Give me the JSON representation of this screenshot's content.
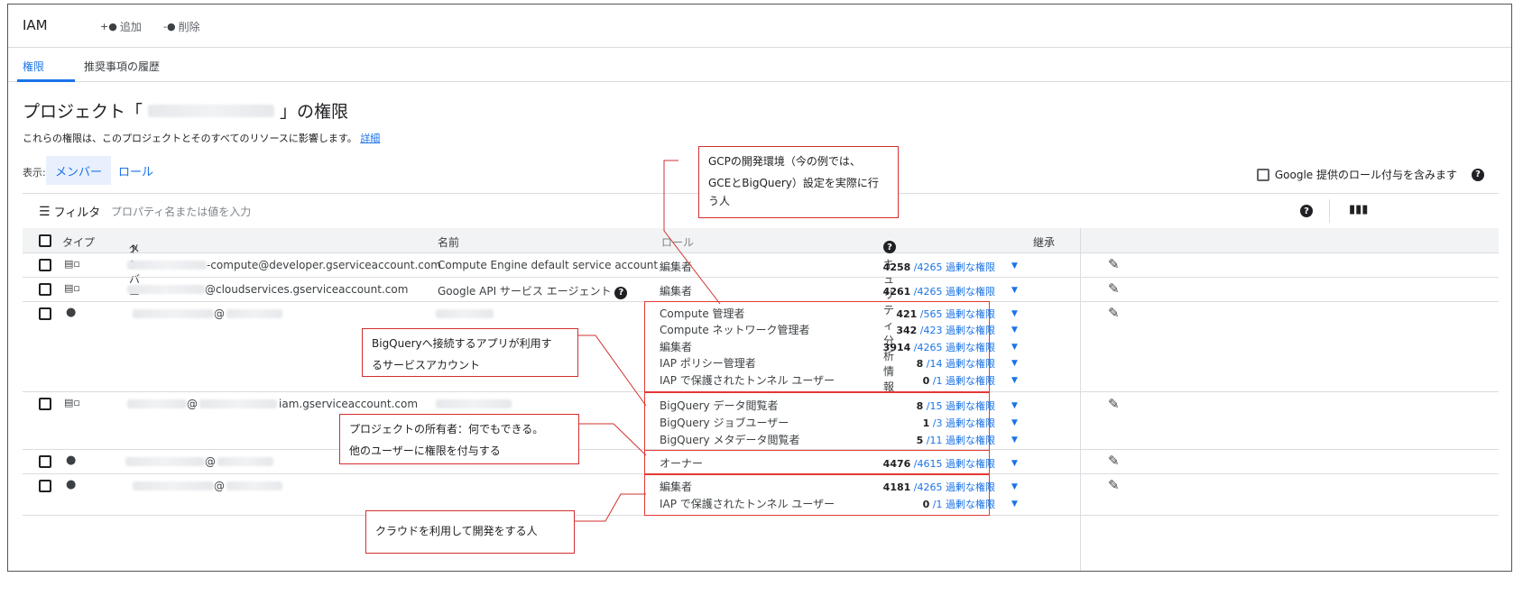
{
  "header": {
    "title": "IAM",
    "add_label": "追加",
    "delete_label": "削除"
  },
  "tabs": [
    {
      "label": "権限"
    },
    {
      "label": "推奨事項の履歴"
    }
  ],
  "page": {
    "title_prefix": "プロジェクト「",
    "title_suffix": "」の権限",
    "description": "これらの権限は、このプロジェクトとそのすべてのリソースに影響します。",
    "details_link": "詳細",
    "view_label": "表示:",
    "view_members": "メンバー",
    "view_roles": "ロール",
    "include_google_label": "Google 提供のロール付与を含みます"
  },
  "filter": {
    "label": "フィルタ",
    "placeholder": "プロパティ名または値を入力"
  },
  "columns": {
    "type": "タイプ",
    "member": "メンバー",
    "name": "名前",
    "role": "ロール",
    "security": "セキュリティ分析情報",
    "inherit": "継承"
  },
  "excess_label": "過剰な権限",
  "rows": [
    {
      "type_icon": "service-account-icon",
      "member": "-compute@developer.gserviceaccount.com",
      "name": "Compute Engine default service account",
      "roles": [
        {
          "role": "編集者",
          "used": "4258",
          "total": "/4265"
        }
      ]
    },
    {
      "type_icon": "service-account-icon",
      "member": "@cloudservices.gserviceaccount.com",
      "name": "Google API サービス エージェント",
      "roles": [
        {
          "role": "編集者",
          "used": "4261",
          "total": "/4265"
        }
      ]
    },
    {
      "type_icon": "person-icon",
      "member": "@",
      "name": "",
      "roles": [
        {
          "role": "Compute 管理者",
          "used": "421",
          "total": "/565"
        },
        {
          "role": "Compute ネットワーク管理者",
          "used": "342",
          "total": "/423"
        },
        {
          "role": "編集者",
          "used": "3914",
          "total": "/4265"
        },
        {
          "role": "IAP ポリシー管理者",
          "used": "8",
          "total": "/14"
        },
        {
          "role": "IAP で保護されたトンネル ユーザー",
          "used": "0",
          "total": "/1"
        }
      ]
    },
    {
      "type_icon": "service-account-icon",
      "member_a": "@",
      "member_b": "iam.gserviceaccount.com",
      "name": "",
      "roles": [
        {
          "role": "BigQuery データ閲覧者",
          "used": "8",
          "total": "/15"
        },
        {
          "role": "BigQuery ジョブユーザー",
          "used": "1",
          "total": "/3"
        },
        {
          "role": "BigQuery メタデータ閲覧者",
          "used": "5",
          "total": "/11"
        }
      ]
    },
    {
      "type_icon": "person-icon",
      "member": "@",
      "name": "",
      "roles": [
        {
          "role": "オーナー",
          "used": "4476",
          "total": "/4615"
        }
      ]
    },
    {
      "type_icon": "person-icon",
      "member": "@",
      "name": "",
      "roles": [
        {
          "role": "編集者",
          "used": "4181",
          "total": "/4265"
        },
        {
          "role": "IAP で保護されたトンネル ユーザー",
          "used": "0",
          "total": "/1"
        }
      ]
    }
  ],
  "annotations": {
    "gcp_dev": [
      "GCPの開発環境（今の例では、",
      "GCEとBigQuery）設定を実際に行",
      "う人"
    ],
    "bigquery_app": [
      "BigQueryへ接続するアプリが利用す",
      "るサービスアカウント"
    ],
    "owner": [
      "プロジェクトの所有者：何でもできる。",
      "他のユーザーに権限を付与する"
    ],
    "cloud_dev": [
      "クラウドを利用して開発をする人"
    ]
  }
}
